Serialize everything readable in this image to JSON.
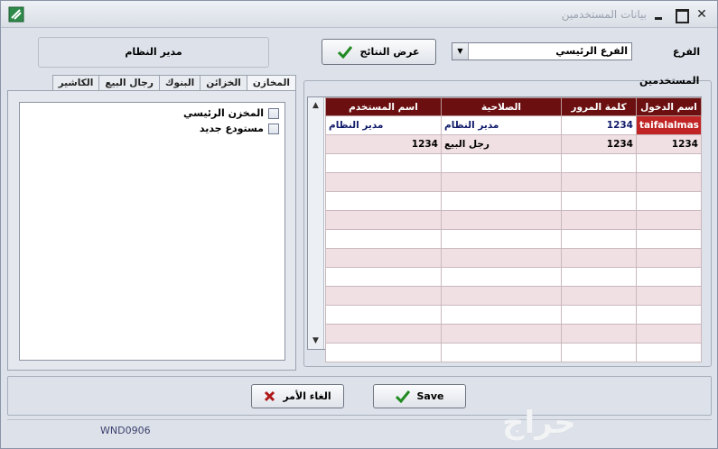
{
  "window": {
    "title": "بيانات المستخدمين",
    "status_code": "WND0906"
  },
  "header": {
    "admin_label": "مدير النظام",
    "show_results_label": "عرض النتائج",
    "branch_label": "الفرع",
    "branch_value": "الفرع الرئيسي"
  },
  "tabs": [
    {
      "label": "المخازن",
      "active": true
    },
    {
      "label": "الخزائن",
      "active": false
    },
    {
      "label": "البنوك",
      "active": false
    },
    {
      "label": "رجال البيع",
      "active": false
    },
    {
      "label": "الكاشير",
      "active": false
    }
  ],
  "warehouses": [
    {
      "label": "المخزن الرئيسي"
    },
    {
      "label": "مستودع جديد"
    }
  ],
  "users": {
    "legend": "المستخدمين",
    "columns": [
      "اسم الدخول",
      "كلمة المرور",
      "الصلاحية",
      "اسم المستخدم"
    ],
    "rows": [
      {
        "login": "taifalalmas",
        "password": "1234",
        "role": "مدير النظام",
        "name": "مدير النظام"
      },
      {
        "login": "1234",
        "password": "1234",
        "role": "رجل البيع",
        "name": "1234"
      }
    ]
  },
  "footer": {
    "cancel_label": "الغاء الأمر",
    "save_label": "Save"
  },
  "watermark": "حراج",
  "colors": {
    "grid_header": "#6b0f10",
    "selected_cell": "#c02424",
    "alt_row": "#f0dfe3",
    "check_green": "#1f8a1f",
    "cancel_red": "#b01818"
  }
}
